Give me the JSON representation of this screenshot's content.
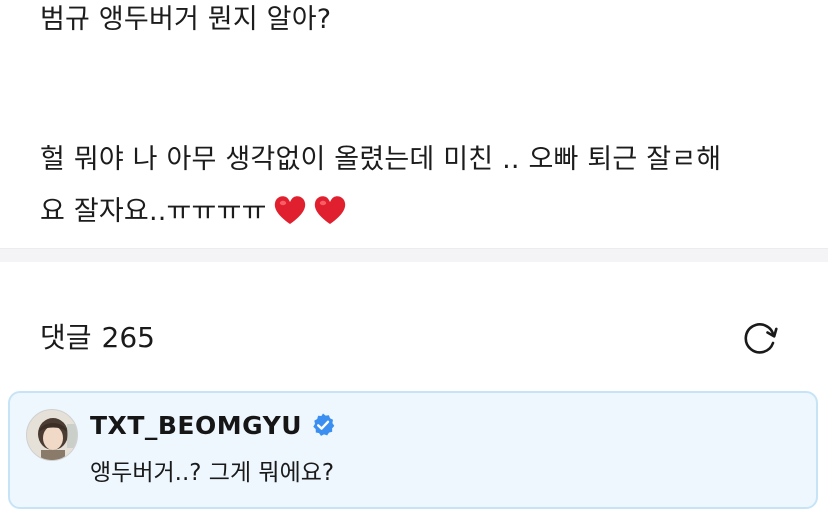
{
  "post": {
    "line1": "범규 앵두버거 뭔지 알아?",
    "line2": "헐 뭐야 나 아무 생각없이 올렸는데 미친 .. 오빠 퇴근 잘ㄹ해",
    "line3": "요 잘자요..ㅠㅠㅠㅠ",
    "emojis": [
      "red-heart-icon",
      "red-heart-icon"
    ]
  },
  "comments": {
    "title": "댓글",
    "count": "265",
    "refresh_icon": "refresh-icon"
  },
  "highlighted_comment": {
    "author": "TXT_BEOMGYU",
    "verified_icon": "verified-badge-icon",
    "text": "앵두버거..? 그게 뭐에요?",
    "background_color": "#eef7fe",
    "border_color": "#c7e4f7"
  },
  "colors": {
    "heart": "#e0202e",
    "verified": "#3b8ff0"
  }
}
